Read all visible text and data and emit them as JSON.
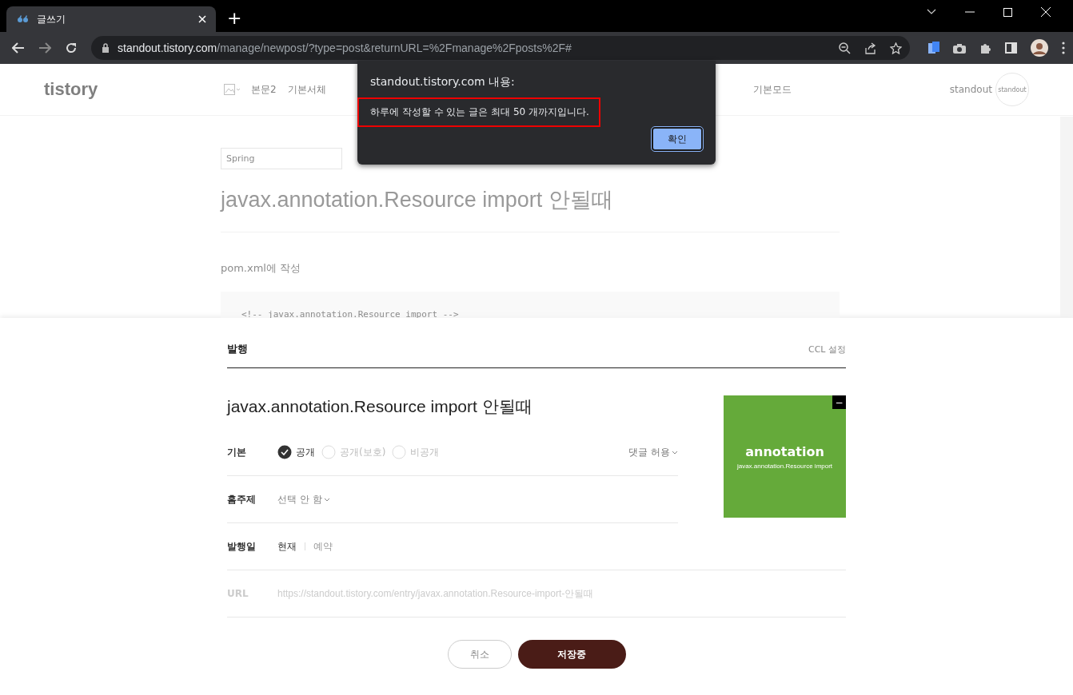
{
  "browser": {
    "tab": {
      "title": "글쓰기"
    },
    "new_tab": "+",
    "url_host": "standout.tistory.com",
    "url_path": "/manage/newpost/?type=post&returnURL=%2Fmanage%2Fposts%2F#"
  },
  "editor": {
    "logo": "tistory",
    "toolbar": [
      "본문2",
      "기본서체",
      "기본모드"
    ],
    "profile": "standout",
    "profile_badge": "standout",
    "category": "Spring",
    "title": "javax.annotation.Resource import 안될때",
    "paragraph": "pom.xml에 작성",
    "code": "<!-- javax.annotation.Resource import -->"
  },
  "dialog": {
    "title": "standout.tistory.com 내용:",
    "message": "하루에 작성할 수 있는 글은 최대 50 개까지입니다.",
    "ok": "확인"
  },
  "publish": {
    "heading": "발행",
    "ccl": "CCL 설정",
    "title": "javax.annotation.Resource import 안될때",
    "visibility_label": "기본",
    "visibility": [
      {
        "label": "공개",
        "selected": true
      },
      {
        "label": "공개(보호)",
        "selected": false
      },
      {
        "label": "비공개",
        "selected": false
      }
    ],
    "comments": "댓글 허용",
    "topic_label": "홈주제",
    "topic": "선택 안 함",
    "date_label": "발행일",
    "date_options": [
      {
        "label": "현재",
        "selected": true
      },
      {
        "label": "예약",
        "selected": false
      }
    ],
    "url_label": "URL",
    "url": "https://standout.tistory.com/entry/javax.annotation.Resource-import-안될때",
    "thumbnail": {
      "title": "annotation",
      "subtitle": "javax.annotation.Resource import",
      "remove": "−"
    },
    "cancel": "취소",
    "save": "저장중"
  }
}
